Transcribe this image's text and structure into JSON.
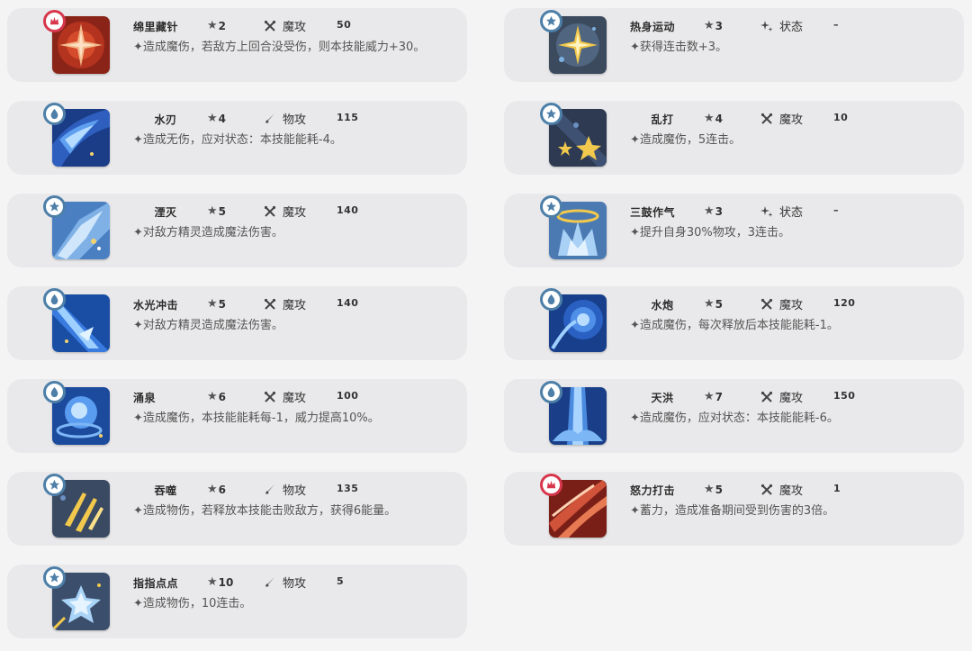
{
  "skills": [
    {
      "name": "绵里藏针",
      "stars": "2",
      "type": "魔攻",
      "power": "50",
      "desc": "✦造成魔伤，若敌方上回合没受伤，则本技能威力+30。",
      "badge": "red",
      "icon": "red-star-icon"
    },
    {
      "name": "热身运动",
      "stars": "3",
      "type": "状态",
      "power": "–",
      "desc": "✦获得连击数+3。",
      "badge": "blue",
      "icon": "sparkle-icon"
    },
    {
      "name": "水刃",
      "stars": "4",
      "type": "物攻",
      "power": "115",
      "desc": "✦造成无伤，应对状态：本技能能耗-4。",
      "badge": "water",
      "icon": "water-blade-icon"
    },
    {
      "name": "乱打",
      "stars": "4",
      "type": "魔攻",
      "power": "10",
      "desc": "✦造成魔伤，5连击。",
      "badge": "blue",
      "icon": "stars-icon"
    },
    {
      "name": "湮灭",
      "stars": "5",
      "type": "魔攻",
      "power": "140",
      "desc": "✦对敌方精灵造成魔法伤害。",
      "badge": "blue",
      "icon": "annihilate-icon"
    },
    {
      "name": "三鼓作气",
      "stars": "3",
      "type": "状态",
      "power": "–",
      "desc": "✦提升自身30%物攻，3连击。",
      "badge": "blue",
      "icon": "crown-icon"
    },
    {
      "name": "水光冲击",
      "stars": "5",
      "type": "魔攻",
      "power": "140",
      "desc": "✦对敌方精灵造成魔法伤害。",
      "badge": "water",
      "icon": "water-strike-icon"
    },
    {
      "name": "水炮",
      "stars": "5",
      "type": "魔攻",
      "power": "120",
      "desc": "✦造成魔伤，每次释放后本技能能耗-1。",
      "badge": "water",
      "icon": "water-cannon-icon"
    },
    {
      "name": "涌泉",
      "stars": "6",
      "type": "魔攻",
      "power": "100",
      "desc": "✦造成魔伤，本技能能耗每-1，威力提高10%。",
      "badge": "water",
      "icon": "spring-icon"
    },
    {
      "name": "天洪",
      "stars": "7",
      "type": "魔攻",
      "power": "150",
      "desc": "✦造成魔伤，应对状态：本技能能耗-6。",
      "badge": "water",
      "icon": "flood-icon"
    },
    {
      "name": "吞噬",
      "stars": "6",
      "type": "物攻",
      "power": "135",
      "desc": "✦造成物伤，若释放本技能击败敌方，获得6能量。",
      "badge": "blue",
      "icon": "claw-icon"
    },
    {
      "name": "怒力打击",
      "stars": "5",
      "type": "魔攻",
      "power": "1",
      "desc": "✦蓄力，造成准备期间受到伤害的3倍。",
      "badge": "red",
      "icon": "red-slash-icon"
    },
    {
      "name": "指指点点",
      "stars": "10",
      "type": "物攻",
      "power": "5",
      "desc": "✦造成物伤，10连击。",
      "badge": "blue",
      "icon": "burst-star-icon"
    }
  ],
  "star_symbol": "★",
  "colors": {
    "card_bg": "#e9e9eb",
    "badge_blue": "#4d7fa8",
    "badge_red": "#d7374d",
    "page_bg": "#f4f4f5"
  }
}
